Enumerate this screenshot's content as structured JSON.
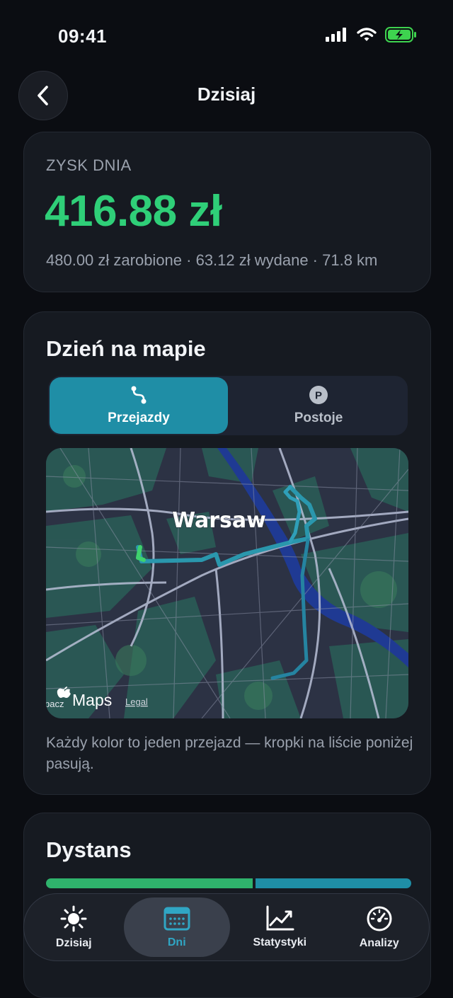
{
  "status": {
    "time": "09:41"
  },
  "header": {
    "title": "Dzisiaj"
  },
  "profit": {
    "label": "ZYSK DNIA",
    "value": "416.88 zł",
    "summary": "480.00 zł zarobione · 63.12 zł wydane · 71.8 km"
  },
  "map_card": {
    "title": "Dzień na mapie",
    "segments": [
      {
        "label": "Przejazdy",
        "icon": "route-icon",
        "selected": true
      },
      {
        "label": "Postoje",
        "icon": "parking-icon",
        "selected": false
      }
    ],
    "map": {
      "city_label": "Warsaw",
      "attribution_brand": "Maps",
      "legal": "Legal",
      "partial_label": "pacz"
    },
    "caption": "Każdy kolor to jeden przejazd — kropki na liście poniżej pasują."
  },
  "distance_card": {
    "title": "Dystans",
    "split": [
      0.57,
      0.43
    ]
  },
  "tabbar": {
    "tabs": [
      {
        "label": "Dzisiaj",
        "icon": "sun-icon",
        "active": false
      },
      {
        "label": "Dni",
        "icon": "calendar-icon",
        "active": true
      },
      {
        "label": "Statystyki",
        "icon": "chart-icon",
        "active": false
      },
      {
        "label": "Analizy",
        "icon": "gauge-icon",
        "active": false
      }
    ]
  },
  "colors": {
    "accent": "#1f8ea6",
    "profit": "#2fcf78",
    "background": "#0b0d12",
    "card": "#161a21"
  }
}
